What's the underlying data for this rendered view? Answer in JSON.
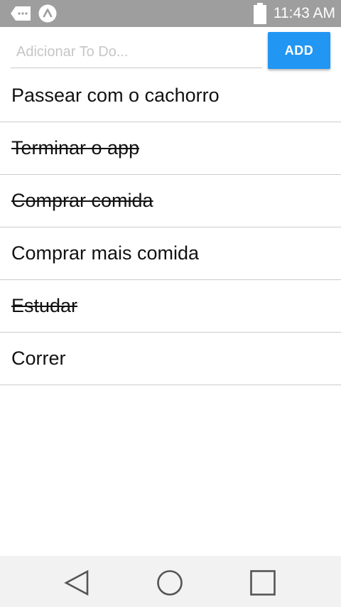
{
  "status_bar": {
    "time": "11:43 AM",
    "left_icons": [
      "message-icon",
      "app-notification-icon"
    ],
    "right_icons": [
      "battery-icon"
    ]
  },
  "input": {
    "placeholder": "Adicionar To Do...",
    "value": ""
  },
  "add_button": {
    "label": "ADD",
    "color": "#2196f3"
  },
  "todos": [
    {
      "text": "Passear com o cachorro",
      "done": false
    },
    {
      "text": "Terminar o app",
      "done": true
    },
    {
      "text": "Comprar comida ",
      "done": true
    },
    {
      "text": "Comprar mais comida",
      "done": false
    },
    {
      "text": "Estudar",
      "done": true
    },
    {
      "text": "Correr",
      "done": false
    }
  ],
  "nav_bar": {
    "buttons": [
      "back-icon",
      "home-icon",
      "recents-icon"
    ]
  }
}
